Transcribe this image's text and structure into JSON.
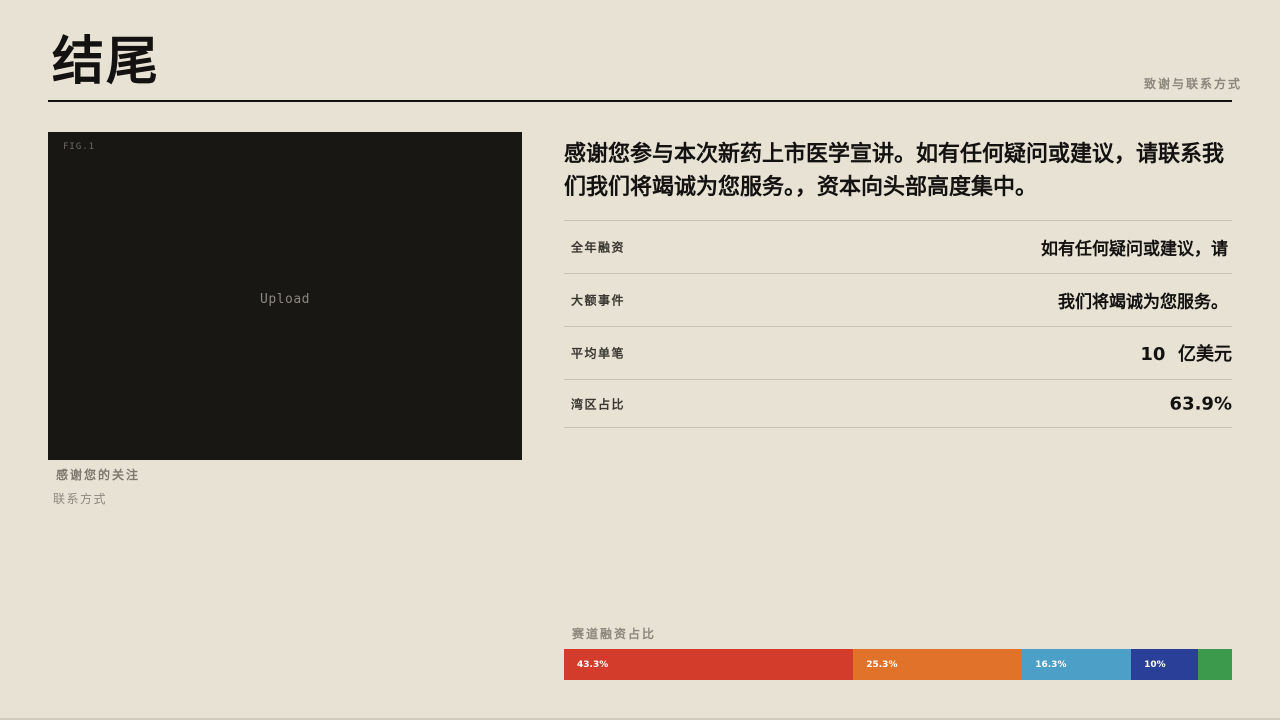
{
  "header": {
    "title": "结尾",
    "tag": "致谢与联系方式"
  },
  "figure": {
    "label": "FIG.1",
    "placeholder": "Upload",
    "caption": "感谢您的关注",
    "caption_sub": "联系方式"
  },
  "lead": "感谢您参与本次新药上市医学宣讲。如有任何疑问或建议，请联系我们我们将竭诚为您服务。，资本向头部高度集中。",
  "stats": [
    {
      "key": "全年融资",
      "value": "如有任何疑问或建议，请"
    },
    {
      "key": "大额事件",
      "value": "我们将竭诚为您服务。"
    },
    {
      "key": "平均单笔",
      "value": "10  亿美元"
    },
    {
      "key": "湾区占比",
      "value": "63.9%"
    }
  ],
  "share": {
    "label": "赛道融资占比",
    "segments": [
      {
        "label": "43.3%",
        "value": 43.3,
        "color": "#d33c2b"
      },
      {
        "label": "25.3%",
        "value": 25.3,
        "color": "#e0722a"
      },
      {
        "label": "16.3%",
        "value": 16.3,
        "color": "#4c9fc6"
      },
      {
        "label": "10%",
        "value": 10,
        "color": "#2a3f97"
      },
      {
        "label": "",
        "value": 5.1,
        "color": "#3c9a4c"
      }
    ]
  }
}
